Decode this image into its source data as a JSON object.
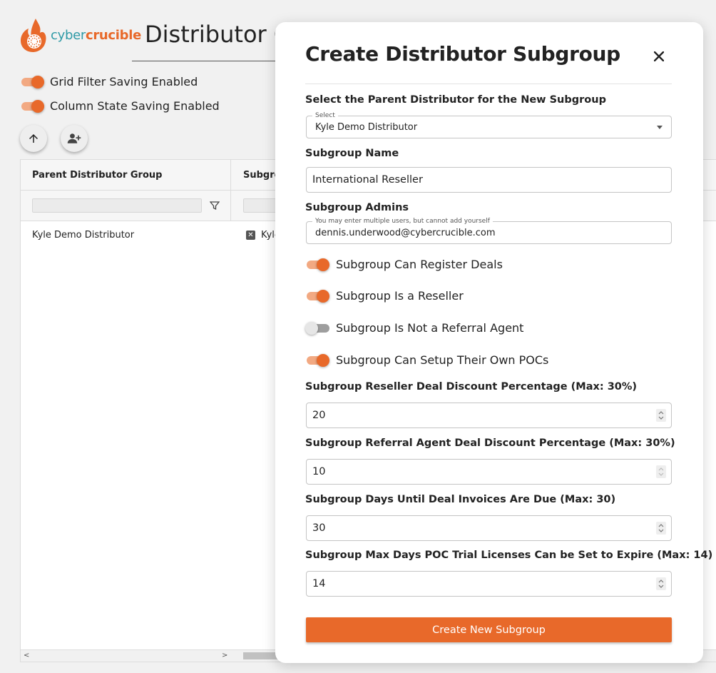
{
  "brand": {
    "part1": "cyber",
    "part2": "crucible",
    "color_primary": "#e8692a",
    "color_secondary": "#2f9aa6"
  },
  "page": {
    "title": "Distributor G",
    "toggles": [
      {
        "label": "Grid Filter Saving Enabled",
        "on": true
      },
      {
        "label": "Column State Saving Enabled",
        "on": true
      }
    ],
    "buttons": [
      {
        "icon": "arrow-up-icon"
      },
      {
        "icon": "add-user-icon"
      }
    ]
  },
  "grid": {
    "columns": [
      "Parent Distributor Group",
      "Subgro"
    ],
    "rows": [
      {
        "parent": "Kyle Demo Distributor",
        "subgroup": "Kyle"
      }
    ],
    "scroll_left": "<",
    "scroll_right": ">"
  },
  "modal": {
    "title": "Create Distributor Subgroup",
    "close_icon": "close-icon",
    "parent": {
      "label": "Select the Parent Distributor for the New Subgroup",
      "legend": "Select",
      "value": "Kyle Demo Distributor"
    },
    "name": {
      "label": "Subgroup Name",
      "value": "International Reseller"
    },
    "admins": {
      "label": "Subgroup Admins",
      "legend": "You may enter multiple users, but cannot add yourself",
      "value": "dennis.underwood@cybercrucible.com"
    },
    "toggles": [
      {
        "label": "Subgroup Can Register Deals",
        "on": true
      },
      {
        "label": "Subgroup Is a Reseller",
        "on": true
      },
      {
        "label": "Subgroup Is Not a Referral Agent",
        "on": false
      },
      {
        "label": "Subgroup Can Setup Their Own POCs",
        "on": true
      }
    ],
    "numbers": [
      {
        "label": "Subgroup Reseller Deal Discount Percentage (Max: 30%)",
        "value": "20"
      },
      {
        "label": "Subgroup Referral Agent Deal Discount Percentage (Max: 30%)",
        "value": "10"
      },
      {
        "label": "Subgroup Days Until Deal Invoices Are Due (Max: 30)",
        "value": "30"
      },
      {
        "label": "Subgroup Max Days POC Trial Licenses Can be Set to Expire (Max: 14)",
        "value": "14"
      }
    ],
    "submit_label": "Create New Subgroup"
  }
}
